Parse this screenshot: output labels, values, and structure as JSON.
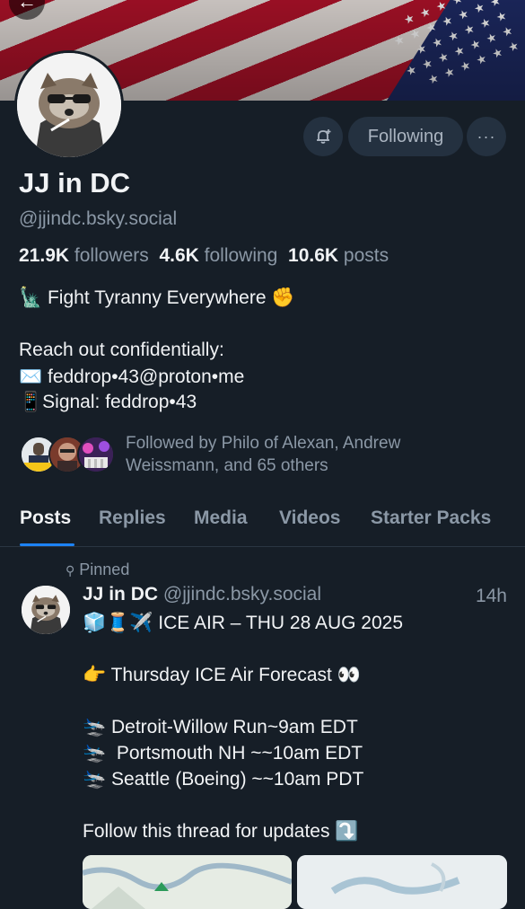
{
  "header": {
    "back_icon": "arrow-left-icon"
  },
  "profile": {
    "name": "JJ in DC",
    "handle": "@jjindc.bsky.social",
    "following_button_label": "Following",
    "stats": {
      "followers_count": "21.9K",
      "followers_label": "followers",
      "following_count": "4.6K",
      "following_label": "following",
      "posts_count": "10.6K",
      "posts_label": "posts"
    },
    "bio": {
      "line1": "🗽 Fight Tyranny Everywhere ✊",
      "line2": "Reach out confidentially:",
      "line3": "✉️ feddrop•43@proton•me",
      "line4": "📱Signal: feddrop•43"
    },
    "followed_by_text": "Followed by Philo of Alexan, Andrew Weissmann, and 65 others"
  },
  "tabs": [
    "Posts",
    "Replies",
    "Media",
    "Videos",
    "Starter Packs"
  ],
  "pinned_post": {
    "pinned_label": "Pinned",
    "author_name": "JJ in DC",
    "author_handle": "@jjindc.bsky.social",
    "time": "14h",
    "lines": [
      "🧊🧵✈️ ICE AIR – THU 28 AUG 2025",
      "👉 Thursday ICE Air Forecast 👀",
      "🛬 Detroit-Willow Run~9am EDT",
      "🛬  Portsmouth NH ~~10am EDT",
      "🛬 Seattle (Boeing) ~~10am PDT",
      "Follow this thread for updates ⤵️"
    ]
  },
  "colors": {
    "background": "#161e27",
    "accent": "#1d83f5",
    "muted": "#8b98a6"
  }
}
